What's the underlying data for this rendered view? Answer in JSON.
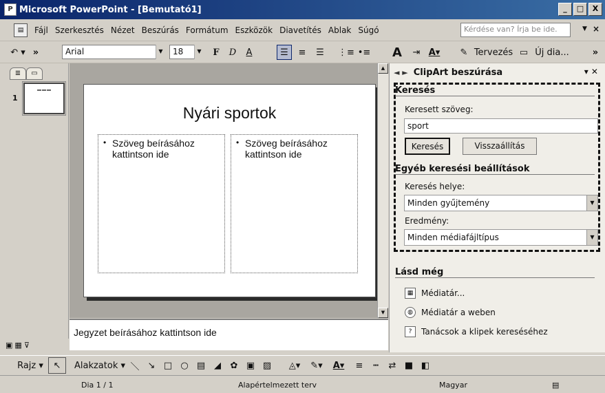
{
  "window": {
    "title": "Microsoft PowerPoint - [Bemutató1]",
    "minimize": "_",
    "restore": "□",
    "close": "X"
  },
  "menu": {
    "items": [
      "Fájl",
      "Szerkesztés",
      "Nézet",
      "Beszúrás",
      "Formátum",
      "Eszközök",
      "Diavetítés",
      "Ablak",
      "Súgó"
    ],
    "help_placeholder": "Kérdése van? Írja be ide.",
    "close": "×"
  },
  "toolbar": {
    "undo": "↶ ▾",
    "more": "»",
    "font": "Arial",
    "size": "18",
    "bold": "F",
    "italic": "D",
    "underline": "A",
    "design_label": "Tervezés",
    "new_slide_label": "Új dia..."
  },
  "left_pane": {
    "slide_number": "1"
  },
  "slide": {
    "title": "Nyári sportok",
    "left_placeholder": "Szöveg beírásához kattintson ide",
    "right_placeholder": "Szöveg beírásához kattintson ide",
    "bullet": "•"
  },
  "notes": {
    "placeholder": "Jegyzet beírásához kattintson ide"
  },
  "task_pane": {
    "title": "ClipArt beszúrása",
    "search_section": "Keresés",
    "search_label": "Keresett szöveg:",
    "search_value": "sport",
    "search_button": "Keresés",
    "reset_button": "Visszaállítás",
    "other_section": "Egyéb keresési beállítások",
    "location_label": "Keresés helye:",
    "location_value": "Minden gyűjtemény",
    "result_label": "Eredmény:",
    "result_value": "Minden médiafájltípus",
    "see_also_section": "Lásd még",
    "links": [
      "Médiatár...",
      "Médiatár a weben",
      "Tanácsok a klipek kereséséhez"
    ]
  },
  "draw_toolbar": {
    "draw_label": "Rajz",
    "shapes_label": "Alakzatok"
  },
  "status": {
    "slide": "Dia 1 / 1",
    "design": "Alapértelmezett terv",
    "language": "Magyar"
  }
}
